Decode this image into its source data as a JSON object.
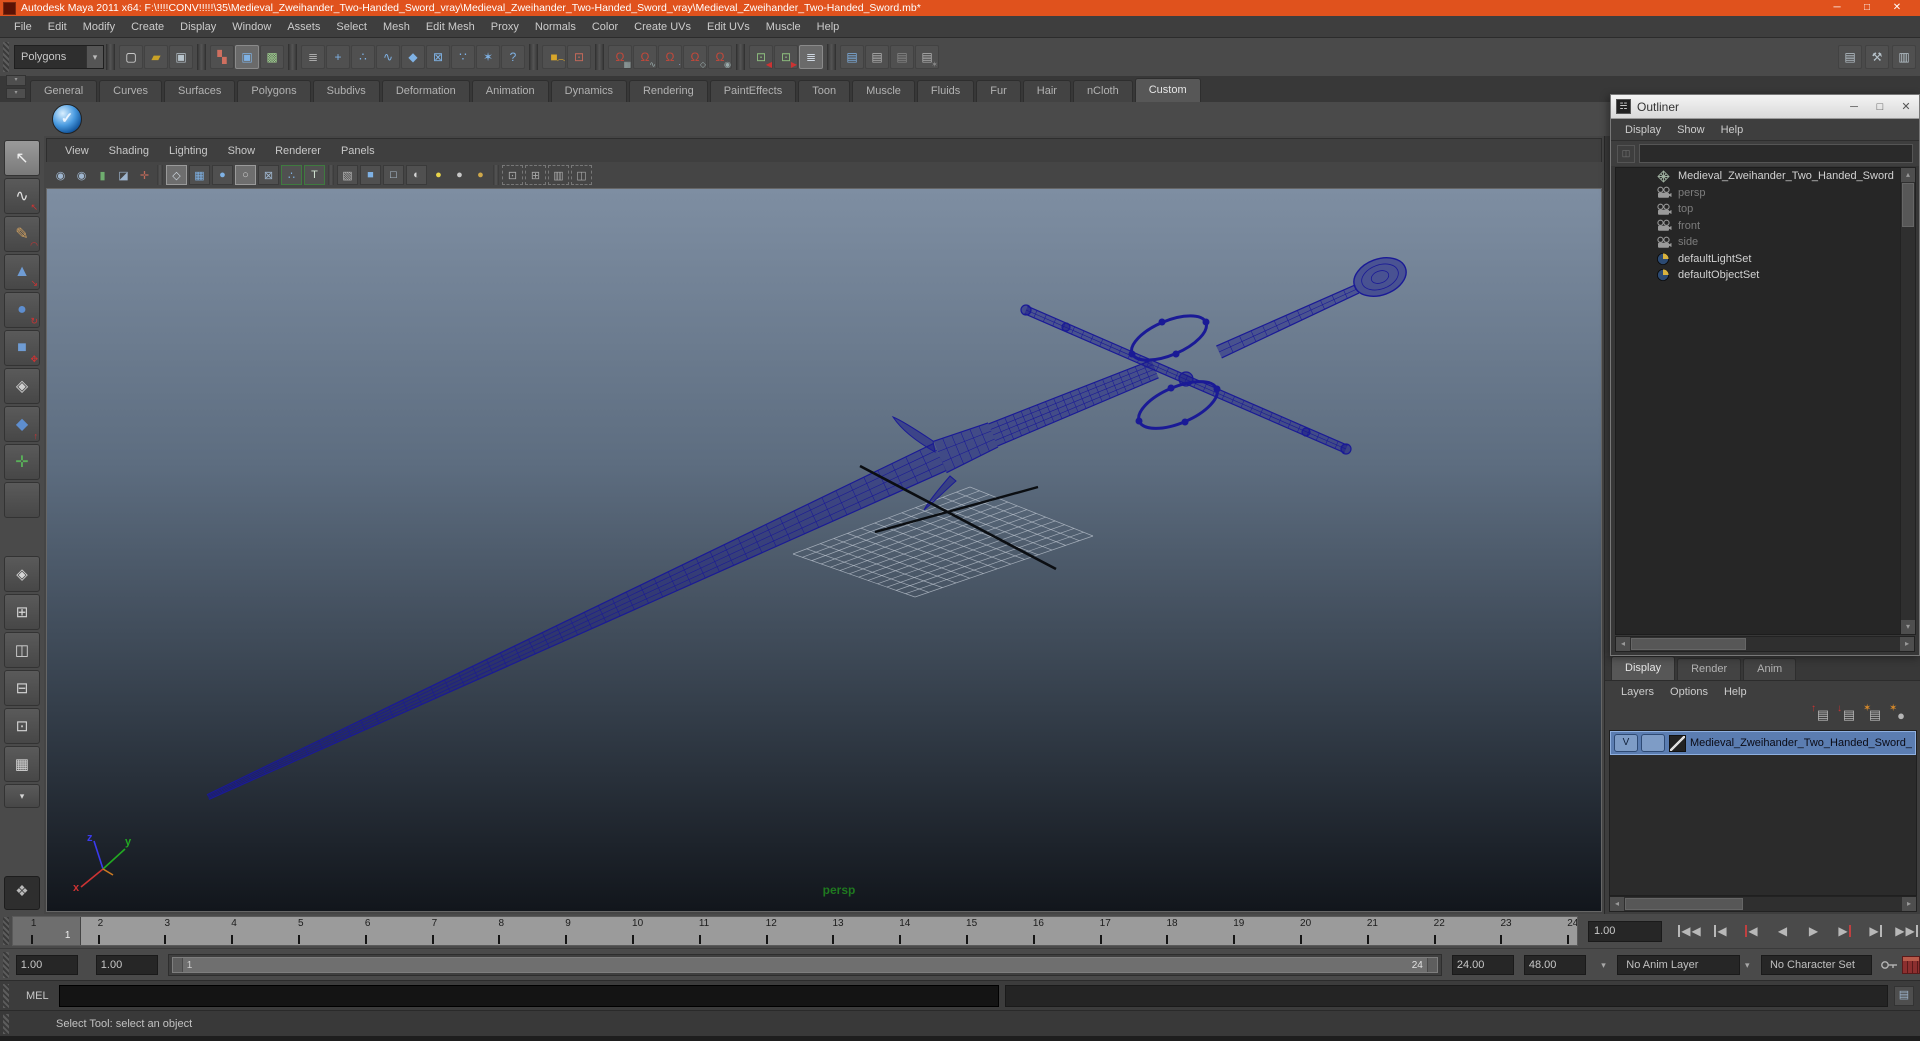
{
  "colors": {
    "titlebar": "#e0521d",
    "sword_wire": "#1a1a96",
    "viewport_top": "#7e8ea2",
    "viewport_bottom": "#12161c",
    "selected_layer": "#5b7db1",
    "persp_label": "#1f7a1f",
    "snap_magnet": "#c4483a"
  },
  "window": {
    "title": "Autodesk Maya 2011 x64: F:\\!!!!CONV!!!!!\\35\\Medieval_Zweihander_Two-Handed_Sword_vray\\Medieval_Zweihander_Two-Handed_Sword_vray\\Medieval_Zweihander_Two-Handed_Sword.mb*",
    "controls": [
      "minimize",
      "maximize",
      "close"
    ]
  },
  "menu_bar": [
    "File",
    "Edit",
    "Modify",
    "Create",
    "Display",
    "Window",
    "Assets",
    "Select",
    "Mesh",
    "Edit Mesh",
    "Proxy",
    "Normals",
    "Color",
    "Create UVs",
    "Edit UVs",
    "Muscle",
    "Help"
  ],
  "status_line": {
    "mode_dropdown": "Polygons",
    "icon_groups": [
      [
        "new-scene",
        "open-scene",
        "save-scene"
      ],
      [
        "select-by-hierarchy",
        "select-by-object",
        "select-by-component"
      ],
      [
        "set-object-mask",
        "mask-handles",
        "mask-points",
        "mask-curves",
        "mask-surfaces",
        "mask-deformations",
        "mask-dynamics",
        "mask-rendering",
        "mask-misc"
      ],
      [
        "lock-selection",
        "highlight-selection"
      ],
      [
        "snap-to-grid",
        "snap-to-curve",
        "snap-to-point",
        "snap-to-plane",
        "make-live"
      ],
      [
        "input-connection",
        "output-connection",
        "construction-history"
      ],
      [
        "render-view",
        "render-current-frame",
        "ipr-render",
        "render-settings"
      ]
    ],
    "sidebar_toggles": [
      "attribute-editor",
      "tool-settings",
      "channel-box"
    ]
  },
  "shelf": {
    "tabs": [
      "General",
      "Curves",
      "Surfaces",
      "Polygons",
      "Subdivs",
      "Deformation",
      "Animation",
      "Dynamics",
      "Rendering",
      "PaintEffects",
      "Toon",
      "Muscle",
      "Fluids",
      "Fur",
      "Hair",
      "nCloth",
      "Custom"
    ],
    "active_tab": "Custom",
    "items": [
      "vray-sphere-button"
    ]
  },
  "toolbox": {
    "tools": [
      "select",
      "lasso",
      "paint-select",
      "move",
      "rotate",
      "scale",
      "universal-manipulator",
      "soft-modification",
      "show-manipulator",
      "last-tool"
    ],
    "active_tool": "select",
    "layouts": [
      "single-pane",
      "four-pane",
      "persp-outliner",
      "persp-graph",
      "hypershade-persp",
      "multi-pane",
      "layout-menu"
    ],
    "plugin_button": "vray"
  },
  "panel": {
    "menus": [
      "View",
      "Shading",
      "Lighting",
      "Show",
      "Renderer",
      "Panels"
    ],
    "toolbar_icons": [
      "pick-camera",
      "camera-attributes",
      "bookmarks",
      "image-plane",
      "two-d-pan",
      "divider",
      "wireframe-mode",
      "smooth-shade",
      "flat-shade",
      "bounding-box",
      "textured-mode",
      "use-all-lights",
      "texture-placement",
      "divider",
      "default-material",
      "cube-shade",
      "cube-light",
      "checker-ball",
      "light-yellow",
      "light-gray",
      "light-gold",
      "divider",
      "isolate-select",
      "xray-mode",
      "gate-mask",
      "resolution-gate"
    ]
  },
  "viewport": {
    "camera_label": "persp",
    "axis": {
      "x": "x",
      "y": "y",
      "z": "z"
    }
  },
  "outliner": {
    "title": "Outliner",
    "window_controls": [
      "minimize",
      "maximize",
      "close"
    ],
    "menus": [
      "Display",
      "Show",
      "Help"
    ],
    "search_value": "",
    "items": [
      {
        "label": "Medieval_Zweihander_Two_Handed_Sword",
        "icon": "mesh",
        "muted": false
      },
      {
        "label": "persp",
        "icon": "camera",
        "muted": true
      },
      {
        "label": "top",
        "icon": "camera",
        "muted": true
      },
      {
        "label": "front",
        "icon": "camera",
        "muted": true
      },
      {
        "label": "side",
        "icon": "camera",
        "muted": true
      },
      {
        "label": "defaultLightSet",
        "icon": "set",
        "muted": false
      },
      {
        "label": "defaultObjectSet",
        "icon": "set",
        "muted": false
      }
    ]
  },
  "layer_editor": {
    "tabs": [
      "Display",
      "Render",
      "Anim"
    ],
    "active_tab": "Display",
    "menus": [
      "Layers",
      "Options",
      "Help"
    ],
    "icons": [
      "move-layer-up",
      "move-layer-down",
      "new-empty-layer",
      "new-layer-from-selected"
    ],
    "layer": {
      "visibility_label": "V",
      "name": "Medieval_Zweihander_Two_Handed_Sword_"
    }
  },
  "time_slider": {
    "start": 1,
    "end": 24,
    "current_frame": "1",
    "current_time_field": "1.00",
    "playback_controls": [
      "go-to-start",
      "step-back-frame",
      "step-back-key",
      "play-backwards",
      "play-forwards",
      "step-forward-key",
      "step-forward-frame",
      "go-to-end"
    ]
  },
  "range_slider": {
    "anim_start": "1.00",
    "playback_start": "1.00",
    "range_start_label": "1",
    "range_end_label": "24",
    "playback_end": "24.00",
    "anim_end": "48.00",
    "anim_layer": "No Anim Layer",
    "character_set": "No Character Set"
  },
  "command_line": {
    "label": "MEL",
    "value": ""
  },
  "help_line": {
    "text": "Select Tool: select an object"
  }
}
